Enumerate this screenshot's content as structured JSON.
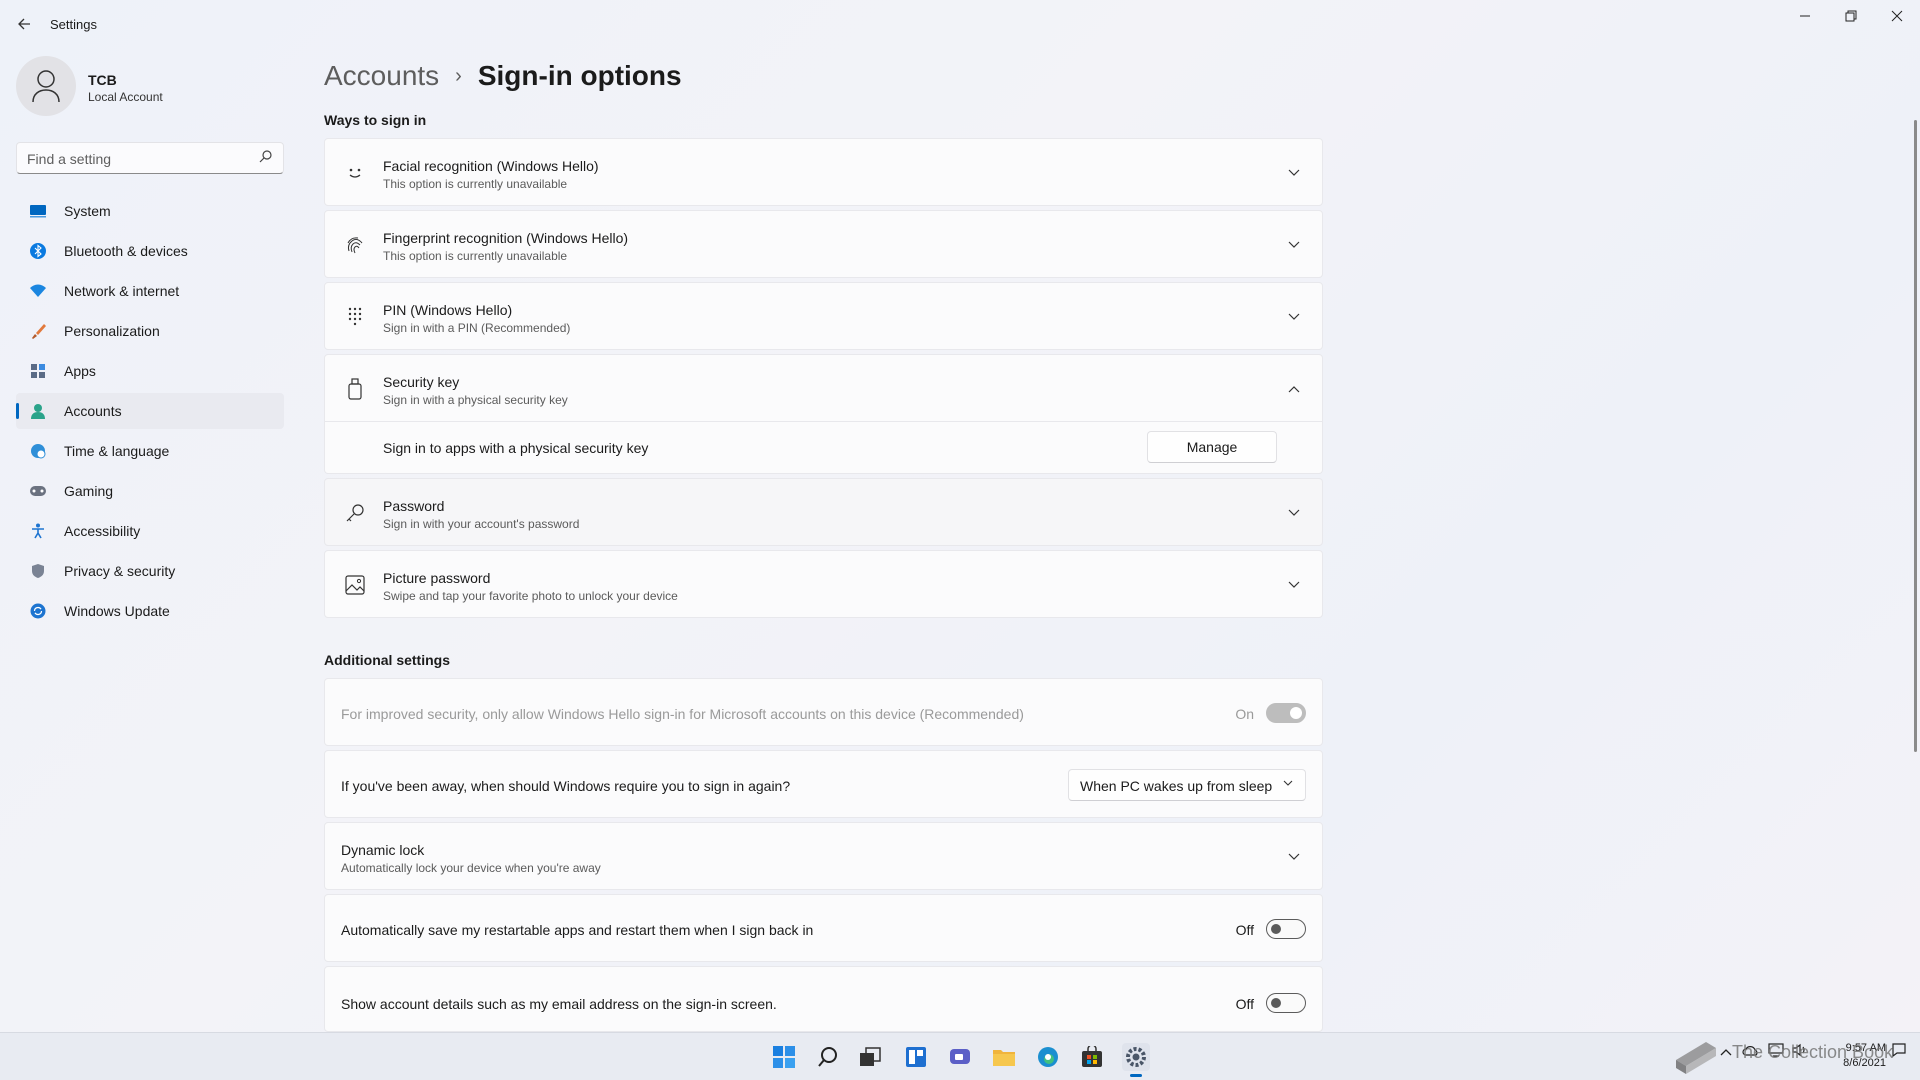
{
  "window": {
    "app_title": "Settings",
    "back_icon": "back-arrow-icon",
    "controls": {
      "minimize": "—",
      "maximize": "❐",
      "close": "✕"
    }
  },
  "profile": {
    "name": "TCB",
    "account_type": "Local Account"
  },
  "search": {
    "placeholder": "Find a setting"
  },
  "sidebar": {
    "items": [
      {
        "label": "System",
        "icon": "system-icon"
      },
      {
        "label": "Bluetooth & devices",
        "icon": "bluetooth-icon"
      },
      {
        "label": "Network & internet",
        "icon": "wifi-icon"
      },
      {
        "label": "Personalization",
        "icon": "brush-icon"
      },
      {
        "label": "Apps",
        "icon": "apps-icon"
      },
      {
        "label": "Accounts",
        "icon": "accounts-icon",
        "active": true
      },
      {
        "label": "Time & language",
        "icon": "globe-clock-icon"
      },
      {
        "label": "Gaming",
        "icon": "gamepad-icon"
      },
      {
        "label": "Accessibility",
        "icon": "accessibility-icon"
      },
      {
        "label": "Privacy & security",
        "icon": "shield-icon"
      },
      {
        "label": "Windows Update",
        "icon": "update-icon"
      }
    ]
  },
  "breadcrumb": {
    "parent": "Accounts",
    "separator": "›",
    "current": "Sign-in options"
  },
  "ways": {
    "title": "Ways to sign in",
    "items": [
      {
        "title": "Facial recognition (Windows Hello)",
        "subtitle": "This option is currently unavailable",
        "icon": "face-icon",
        "expanded": false
      },
      {
        "title": "Fingerprint recognition (Windows Hello)",
        "subtitle": "This option is currently unavailable",
        "icon": "fingerprint-icon",
        "expanded": false
      },
      {
        "title": "PIN (Windows Hello)",
        "subtitle": "Sign in with a PIN (Recommended)",
        "icon": "pin-keypad-icon",
        "expanded": false
      },
      {
        "title": "Security key",
        "subtitle": "Sign in with a physical security key",
        "icon": "usb-key-icon",
        "expanded": true
      },
      {
        "title": "Password",
        "subtitle": "Sign in with your account's password",
        "icon": "key-icon",
        "expanded": false
      },
      {
        "title": "Picture password",
        "subtitle": "Swipe and tap your favorite photo to unlock your device",
        "icon": "picture-icon",
        "expanded": false
      }
    ],
    "security_key_detail": {
      "text": "Sign in to apps with a physical security key",
      "button": "Manage"
    }
  },
  "additional": {
    "title": "Additional settings",
    "hello_only": {
      "text": "For improved security, only allow Windows Hello sign-in for Microsoft accounts on this device (Recommended)",
      "state_label": "On",
      "disabled": true
    },
    "require_signin": {
      "text": "If you've been away, when should Windows require you to sign in again?",
      "selected": "When PC wakes up from sleep"
    },
    "dynamic_lock": {
      "title": "Dynamic lock",
      "subtitle": "Automatically lock your device when you're away"
    },
    "restart_apps": {
      "text": "Automatically save my restartable apps and restart them when I sign back in",
      "state_label": "Off"
    },
    "account_details": {
      "text": "Show account details such as my email address on the sign-in screen.",
      "state_label": "Off"
    }
  },
  "taskbar": {
    "icons": [
      "start-icon",
      "search-icon",
      "task-view-icon",
      "widgets-icon",
      "chat-icon",
      "file-explorer-icon",
      "edge-icon",
      "store-icon",
      "settings-icon"
    ],
    "clock": {
      "time": "9:57 AM",
      "date": "8/6/2021"
    },
    "watermark": "The Collection Book"
  },
  "colors": {
    "accent": "#0067c0",
    "background": "#f3f3f8"
  }
}
